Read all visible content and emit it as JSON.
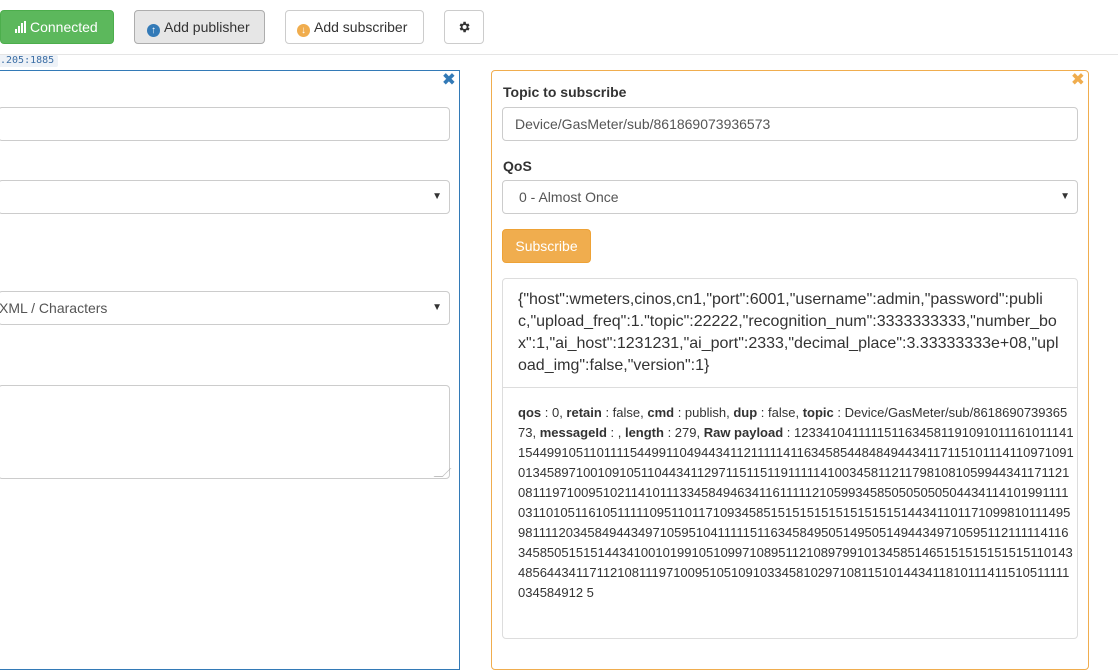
{
  "toolbar": {
    "connected_label": "Connected",
    "add_publisher_label": "Add publisher",
    "add_subscriber_label": "Add subscriber",
    "settings_icon": "gear-icon"
  },
  "host_fragment": ".205:1885",
  "publisher": {
    "payload_type": "XML / Characters",
    "close_icon": "close-icon"
  },
  "subscriber": {
    "topic_label": "Topic to subscribe",
    "topic_value": "Device/GasMeter/sub/861869073936573",
    "qos_label": "QoS",
    "qos_value": "0 - Almost Once",
    "subscribe_label": "Subscribe",
    "message": {
      "payload": "{\"host\":wmeters,cinos,cn1,\"port\":6001,\"username\":admin,\"password\":public,\"upload_freq\":1.\"topic\":22222,\"recognition_num\":3333333333,\"number_box\":1,\"ai_host\":1231231,\"ai_port\":2333,\"decimal_place\":3.33333333e+08,\"upload_img\":false,\"version\":1}",
      "qos_key": "qos",
      "qos_val": " : 0, ",
      "retain_key": "retain",
      "retain_val": " : false, ",
      "cmd_key": "cmd",
      "cmd_val": " : publish, ",
      "dup_key": "dup",
      "dup_val": " : false, ",
      "topic_key": "topic",
      "topic_val": " : Device/GasMeter/sub/861869073936573, ",
      "messageid_key": "messageId",
      "messageid_val": " : , ",
      "length_key": "length",
      "length_val": " : 279, ",
      "raw_key": "Raw payload",
      "raw_val": " : 1233410411111511634581191091011161011141154499105110111154499110494434112111114116345854484849443411711510111411097109101345897100109105110443411297115115119111114100345811211798108105994434117112108111971009510211410111334584946341161111121059934585050505050443411410199111103110105116105111110951101171093458515151515151515151514434110117109981011149598111120345849443497105951041111151163458495051495051494434971059511211111411634585051515144341001019910510997108951121089799101345851465151515151515110143485644341171121081119710095105109103345810297108115101443411810111411510511111034584912 5"
    }
  }
}
